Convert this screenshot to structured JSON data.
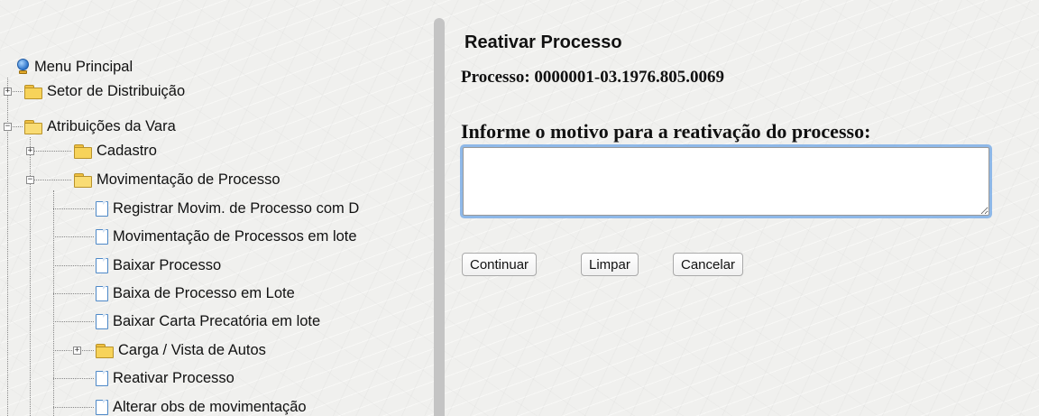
{
  "menu": {
    "root_label": "Menu Principal",
    "items": [
      {
        "label": "Setor de Distribuição",
        "state": "collapsed"
      },
      {
        "label": "Atribuições da Vara",
        "state": "expanded"
      },
      {
        "label": "Cadastro",
        "state": "collapsed"
      },
      {
        "label": "Movimentação de Processo",
        "state": "expanded"
      },
      {
        "label": "Registrar Movim. de Processo com D"
      },
      {
        "label": "Movimentação de Processos em lote"
      },
      {
        "label": "Baixar Processo"
      },
      {
        "label": "Baixa de Processo em Lote"
      },
      {
        "label": "Baixar Carta Precatória em lote"
      },
      {
        "label": "Carga / Vista de Autos",
        "state": "collapsed"
      },
      {
        "label": "Reativar Processo"
      },
      {
        "label": "Alterar obs de movimentação"
      }
    ]
  },
  "main": {
    "title": "Reativar Processo",
    "processo_text": "Processo: 0000001-03.1976.805.0069",
    "motivo_label": "Informe o motivo para a reativação do processo:",
    "motivo_value": "",
    "buttons": {
      "continuar": "Continuar",
      "limpar": "Limpar",
      "cancelar": "Cancelar"
    }
  },
  "icons": {
    "root": "globe-icon",
    "folder": "folder-icon",
    "document": "document-icon",
    "expand": "plus-box-icon",
    "collapse": "minus-box-icon"
  },
  "colors": {
    "focus_ring": "#6ea5e6",
    "folder": "#f7d35a",
    "document_border": "#4d88c7"
  }
}
